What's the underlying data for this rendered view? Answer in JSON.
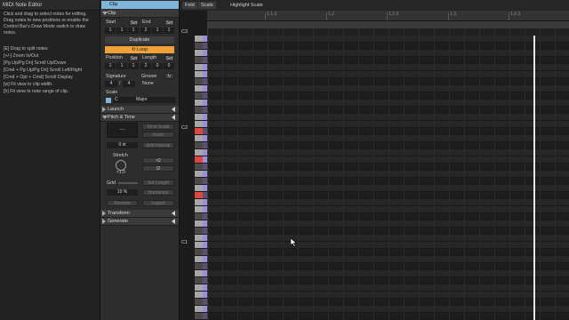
{
  "info": {
    "title": "MIDI Note Editor",
    "lines": [
      "Click and drag to select notes for editing. Drag notes to new positions or enable the Control Bar's Draw Mode switch to draw notes.",
      "[E] Drag to split notes",
      "[+/-] Zoom In/Out",
      "[Pg Up/Pg Dn] Scroll Up/Down",
      "[Cmd + Pg Up/Pg Dn] Scroll Left/Right",
      "[Cmd + Opt + Cmd] Scroll Display",
      "[w] Fit view to clip width.",
      "[h] Fit view to note range of clip."
    ]
  },
  "clip_panel": {
    "tab": "Clip",
    "section_clip": "Clip",
    "start_label": "Start",
    "end_label": "End",
    "set_label": "Set",
    "start_values": [
      "1",
      "1",
      "1"
    ],
    "end_values": [
      "2",
      "1",
      "1"
    ],
    "duplicate_label": "Duplicate",
    "loop_label": "Loop",
    "position_label": "Position",
    "length_label": "Length",
    "position_values": [
      "1",
      "1",
      "1"
    ],
    "length_values": [
      "2",
      "0",
      "0"
    ],
    "signature_label": "Signature",
    "signature_num": "4",
    "signature_den": "4",
    "groove_label": "Groove",
    "groove_value": "None",
    "scale_label": "Scale",
    "scale_root": "C",
    "scale_name": "Major",
    "launch_label": "Launch",
    "pitch_time_label": "Pitch & Time",
    "pitch_box": "—",
    "fit_to_scale": "Fit to Scale",
    "invert": "Invert",
    "semitones": "0 st",
    "add_interval": "Add Interval",
    "stretch_label": "Stretch",
    "times_two": "×2",
    "div_two": "/2",
    "stretch_value": "×1.0",
    "grid_label": "Grid",
    "set_length": "Set Length",
    "percent": "10 %",
    "humanize": "Humanize",
    "reverse": "Reverse",
    "legato": "Legato",
    "transform_label": "Transform",
    "generate_label": "Generate"
  },
  "editor": {
    "fold": "Fold",
    "scale": "Scale",
    "highlight_scale": "Highlight Scale",
    "ruler_ticks": [
      "1.1.3",
      "1.2",
      "1.2.3",
      "1.3",
      "1.3.3"
    ],
    "key_labels": [
      "C3",
      "C2",
      "C1"
    ]
  },
  "colors": {
    "accent_blue": "#7fb6d9",
    "loop_orange": "#f0a13a",
    "scale_red": "#e0463f",
    "purple_strip": "#9c8fd8"
  }
}
